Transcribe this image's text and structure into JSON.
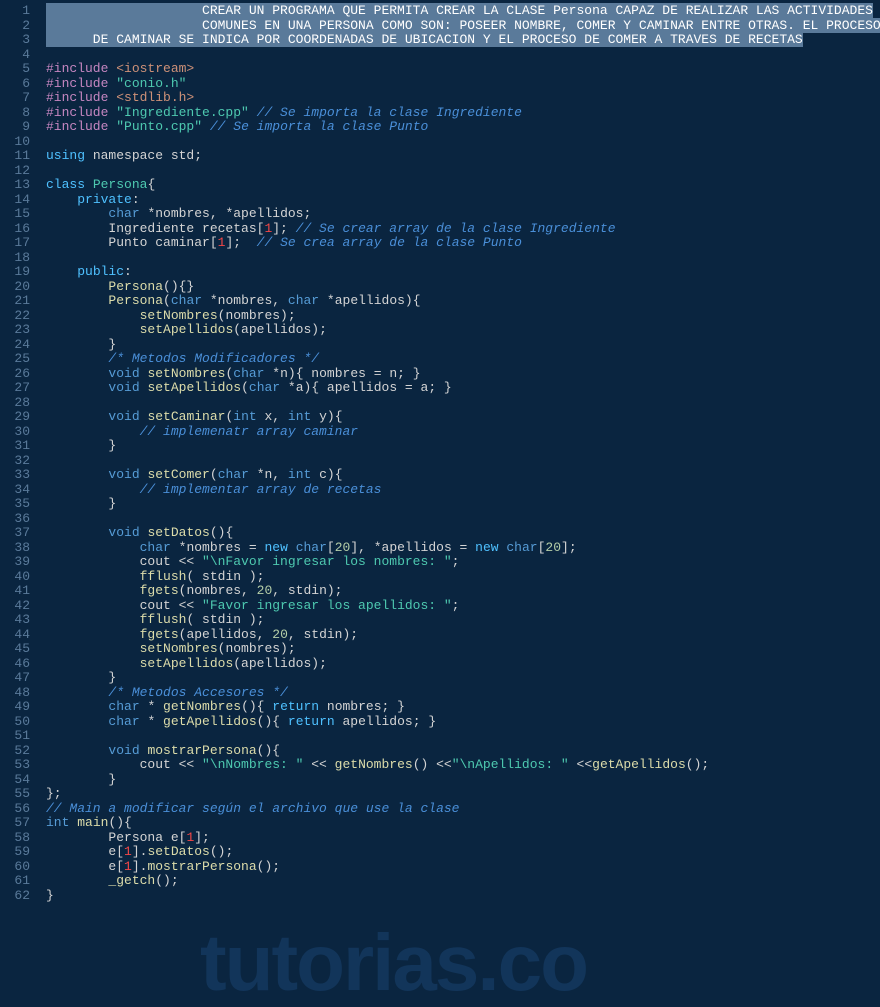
{
  "watermark": "tutorias.co",
  "lines": [
    {
      "n": 1,
      "tokens": [
        {
          "c": "hl-bg",
          "t": "                    CREAR UN PROGRAMA QUE PERMITA CREAR LA CLASE Persona CAPAZ DE REALIZAR LAS ACTIVIDADES"
        }
      ]
    },
    {
      "n": 2,
      "tokens": [
        {
          "c": "hl-bg",
          "t": "                    COMUNES EN UNA PERSONA COMO SON: POSEER NOMBRE, COMER Y CAMINAR ENTRE OTRAS. EL PROCESO"
        }
      ]
    },
    {
      "n": 3,
      "tokens": [
        {
          "c": "hl-bg",
          "t": "      DE CAMINAR SE INDICA POR COORDENADAS DE UBICACION Y EL PROCESO DE COMER A TRAVES DE RECETAS"
        }
      ]
    },
    {
      "n": 4,
      "tokens": []
    },
    {
      "n": 5,
      "tokens": [
        {
          "c": "tk-preproc",
          "t": "#include "
        },
        {
          "c": "tk-string",
          "t": "<iostream>"
        }
      ]
    },
    {
      "n": 6,
      "tokens": [
        {
          "c": "tk-preproc",
          "t": "#include "
        },
        {
          "c": "tk-string2",
          "t": "\"conio.h\""
        }
      ]
    },
    {
      "n": 7,
      "tokens": [
        {
          "c": "tk-preproc",
          "t": "#include "
        },
        {
          "c": "tk-string",
          "t": "<stdlib.h>"
        }
      ]
    },
    {
      "n": 8,
      "tokens": [
        {
          "c": "tk-preproc",
          "t": "#include "
        },
        {
          "c": "tk-string2",
          "t": "\"Ingrediente.cpp\""
        },
        {
          "c": "",
          "t": " "
        },
        {
          "c": "tk-comment2",
          "t": "// Se importa la clase Ingrediente"
        }
      ]
    },
    {
      "n": 9,
      "tokens": [
        {
          "c": "tk-preproc",
          "t": "#include "
        },
        {
          "c": "tk-string2",
          "t": "\"Punto.cpp\""
        },
        {
          "c": "",
          "t": " "
        },
        {
          "c": "tk-comment2",
          "t": "// Se importa la clase Punto"
        }
      ]
    },
    {
      "n": 10,
      "tokens": []
    },
    {
      "n": 11,
      "tokens": [
        {
          "c": "tk-keyword",
          "t": "using"
        },
        {
          "c": "",
          "t": " namespace std;"
        }
      ]
    },
    {
      "n": 12,
      "tokens": []
    },
    {
      "n": 13,
      "tokens": [
        {
          "c": "tk-keyword",
          "t": "class"
        },
        {
          "c": "",
          "t": " "
        },
        {
          "c": "tk-class",
          "t": "Persona"
        },
        {
          "c": "",
          "t": "{"
        }
      ]
    },
    {
      "n": 14,
      "tokens": [
        {
          "c": "",
          "t": "    "
        },
        {
          "c": "tk-keyword",
          "t": "private"
        },
        {
          "c": "",
          "t": ":"
        }
      ]
    },
    {
      "n": 15,
      "tokens": [
        {
          "c": "",
          "t": "        "
        },
        {
          "c": "tk-type",
          "t": "char"
        },
        {
          "c": "",
          "t": " *nombres, *apellidos;"
        }
      ]
    },
    {
      "n": 16,
      "tokens": [
        {
          "c": "",
          "t": "        Ingrediente recetas["
        },
        {
          "c": "tk-red",
          "t": "1"
        },
        {
          "c": "",
          "t": "]; "
        },
        {
          "c": "tk-comment2",
          "t": "// Se crear array de la clase Ingrediente"
        }
      ]
    },
    {
      "n": 17,
      "tokens": [
        {
          "c": "",
          "t": "        Punto caminar["
        },
        {
          "c": "tk-red",
          "t": "1"
        },
        {
          "c": "",
          "t": "];  "
        },
        {
          "c": "tk-comment2",
          "t": "// Se crea array de la clase Punto"
        }
      ]
    },
    {
      "n": 18,
      "tokens": []
    },
    {
      "n": 19,
      "tokens": [
        {
          "c": "",
          "t": "    "
        },
        {
          "c": "tk-keyword",
          "t": "public"
        },
        {
          "c": "",
          "t": ":"
        }
      ]
    },
    {
      "n": 20,
      "tokens": [
        {
          "c": "",
          "t": "        "
        },
        {
          "c": "tk-func",
          "t": "Persona"
        },
        {
          "c": "",
          "t": "(){}"
        }
      ]
    },
    {
      "n": 21,
      "tokens": [
        {
          "c": "",
          "t": "        "
        },
        {
          "c": "tk-func",
          "t": "Persona"
        },
        {
          "c": "",
          "t": "("
        },
        {
          "c": "tk-type",
          "t": "char"
        },
        {
          "c": "",
          "t": " *nombres, "
        },
        {
          "c": "tk-type",
          "t": "char"
        },
        {
          "c": "",
          "t": " *apellidos){"
        }
      ]
    },
    {
      "n": 22,
      "tokens": [
        {
          "c": "",
          "t": "            "
        },
        {
          "c": "tk-func",
          "t": "setNombres"
        },
        {
          "c": "",
          "t": "(nombres);"
        }
      ]
    },
    {
      "n": 23,
      "tokens": [
        {
          "c": "",
          "t": "            "
        },
        {
          "c": "tk-func",
          "t": "setApellidos"
        },
        {
          "c": "",
          "t": "(apellidos);"
        }
      ]
    },
    {
      "n": 24,
      "tokens": [
        {
          "c": "",
          "t": "        }"
        }
      ]
    },
    {
      "n": 25,
      "tokens": [
        {
          "c": "",
          "t": "        "
        },
        {
          "c": "tk-comment2",
          "t": "/* Metodos Modificadores */"
        }
      ]
    },
    {
      "n": 26,
      "tokens": [
        {
          "c": "",
          "t": "        "
        },
        {
          "c": "tk-type",
          "t": "void"
        },
        {
          "c": "",
          "t": " "
        },
        {
          "c": "tk-func",
          "t": "setNombres"
        },
        {
          "c": "",
          "t": "("
        },
        {
          "c": "tk-type",
          "t": "char"
        },
        {
          "c": "",
          "t": " *n){ nombres = n; }"
        }
      ]
    },
    {
      "n": 27,
      "tokens": [
        {
          "c": "",
          "t": "        "
        },
        {
          "c": "tk-type",
          "t": "void"
        },
        {
          "c": "",
          "t": " "
        },
        {
          "c": "tk-func",
          "t": "setApellidos"
        },
        {
          "c": "",
          "t": "("
        },
        {
          "c": "tk-type",
          "t": "char"
        },
        {
          "c": "",
          "t": " *a){ apellidos = a; }"
        }
      ]
    },
    {
      "n": 28,
      "tokens": []
    },
    {
      "n": 29,
      "tokens": [
        {
          "c": "",
          "t": "        "
        },
        {
          "c": "tk-type",
          "t": "void"
        },
        {
          "c": "",
          "t": " "
        },
        {
          "c": "tk-func",
          "t": "setCaminar"
        },
        {
          "c": "",
          "t": "("
        },
        {
          "c": "tk-type",
          "t": "int"
        },
        {
          "c": "",
          "t": " x, "
        },
        {
          "c": "tk-type",
          "t": "int"
        },
        {
          "c": "",
          "t": " y){"
        }
      ]
    },
    {
      "n": 30,
      "tokens": [
        {
          "c": "",
          "t": "            "
        },
        {
          "c": "tk-comment2",
          "t": "// implemenatr array caminar"
        }
      ]
    },
    {
      "n": 31,
      "tokens": [
        {
          "c": "",
          "t": "        }"
        }
      ]
    },
    {
      "n": 32,
      "tokens": []
    },
    {
      "n": 33,
      "tokens": [
        {
          "c": "",
          "t": "        "
        },
        {
          "c": "tk-type",
          "t": "void"
        },
        {
          "c": "",
          "t": " "
        },
        {
          "c": "tk-func",
          "t": "setComer"
        },
        {
          "c": "",
          "t": "("
        },
        {
          "c": "tk-type",
          "t": "char"
        },
        {
          "c": "",
          "t": " *n, "
        },
        {
          "c": "tk-type",
          "t": "int"
        },
        {
          "c": "",
          "t": " c){"
        }
      ]
    },
    {
      "n": 34,
      "tokens": [
        {
          "c": "",
          "t": "            "
        },
        {
          "c": "tk-comment2",
          "t": "// implementar array de recetas"
        }
      ]
    },
    {
      "n": 35,
      "tokens": [
        {
          "c": "",
          "t": "        }"
        }
      ]
    },
    {
      "n": 36,
      "tokens": []
    },
    {
      "n": 37,
      "tokens": [
        {
          "c": "",
          "t": "        "
        },
        {
          "c": "tk-type",
          "t": "void"
        },
        {
          "c": "",
          "t": " "
        },
        {
          "c": "tk-func",
          "t": "setDatos"
        },
        {
          "c": "",
          "t": "(){"
        }
      ]
    },
    {
      "n": 38,
      "tokens": [
        {
          "c": "",
          "t": "            "
        },
        {
          "c": "tk-type",
          "t": "char"
        },
        {
          "c": "",
          "t": " *nombres = "
        },
        {
          "c": "tk-keyword",
          "t": "new"
        },
        {
          "c": "",
          "t": " "
        },
        {
          "c": "tk-type",
          "t": "char"
        },
        {
          "c": "",
          "t": "["
        },
        {
          "c": "tk-number",
          "t": "20"
        },
        {
          "c": "",
          "t": "], *apellidos = "
        },
        {
          "c": "tk-keyword",
          "t": "new"
        },
        {
          "c": "",
          "t": " "
        },
        {
          "c": "tk-type",
          "t": "char"
        },
        {
          "c": "",
          "t": "["
        },
        {
          "c": "tk-number",
          "t": "20"
        },
        {
          "c": "",
          "t": "];"
        }
      ]
    },
    {
      "n": 39,
      "tokens": [
        {
          "c": "",
          "t": "            cout << "
        },
        {
          "c": "tk-string2",
          "t": "\"\\nFavor ingresar los nombres: \""
        },
        {
          "c": "",
          "t": ";"
        }
      ]
    },
    {
      "n": 40,
      "tokens": [
        {
          "c": "",
          "t": "            "
        },
        {
          "c": "tk-func",
          "t": "fflush"
        },
        {
          "c": "",
          "t": "( stdin );"
        }
      ]
    },
    {
      "n": 41,
      "tokens": [
        {
          "c": "",
          "t": "            "
        },
        {
          "c": "tk-func",
          "t": "fgets"
        },
        {
          "c": "",
          "t": "(nombres, "
        },
        {
          "c": "tk-number",
          "t": "20"
        },
        {
          "c": "",
          "t": ", stdin);"
        }
      ]
    },
    {
      "n": 42,
      "tokens": [
        {
          "c": "",
          "t": "            cout << "
        },
        {
          "c": "tk-string2",
          "t": "\"Favor ingresar los apellidos: \""
        },
        {
          "c": "",
          "t": ";"
        }
      ]
    },
    {
      "n": 43,
      "tokens": [
        {
          "c": "",
          "t": "            "
        },
        {
          "c": "tk-func",
          "t": "fflush"
        },
        {
          "c": "",
          "t": "( stdin );"
        }
      ]
    },
    {
      "n": 44,
      "tokens": [
        {
          "c": "",
          "t": "            "
        },
        {
          "c": "tk-func",
          "t": "fgets"
        },
        {
          "c": "",
          "t": "(apellidos, "
        },
        {
          "c": "tk-number",
          "t": "20"
        },
        {
          "c": "",
          "t": ", stdin);"
        }
      ]
    },
    {
      "n": 45,
      "tokens": [
        {
          "c": "",
          "t": "            "
        },
        {
          "c": "tk-func",
          "t": "setNombres"
        },
        {
          "c": "",
          "t": "(nombres);"
        }
      ]
    },
    {
      "n": 46,
      "tokens": [
        {
          "c": "",
          "t": "            "
        },
        {
          "c": "tk-func",
          "t": "setApellidos"
        },
        {
          "c": "",
          "t": "(apellidos);"
        }
      ]
    },
    {
      "n": 47,
      "tokens": [
        {
          "c": "",
          "t": "        }"
        }
      ]
    },
    {
      "n": 48,
      "tokens": [
        {
          "c": "",
          "t": "        "
        },
        {
          "c": "tk-comment2",
          "t": "/* Metodos Accesores */"
        }
      ]
    },
    {
      "n": 49,
      "tokens": [
        {
          "c": "",
          "t": "        "
        },
        {
          "c": "tk-type",
          "t": "char"
        },
        {
          "c": "",
          "t": " * "
        },
        {
          "c": "tk-func",
          "t": "getNombres"
        },
        {
          "c": "",
          "t": "(){ "
        },
        {
          "c": "tk-keyword",
          "t": "return"
        },
        {
          "c": "",
          "t": " nombres; }"
        }
      ]
    },
    {
      "n": 50,
      "tokens": [
        {
          "c": "",
          "t": "        "
        },
        {
          "c": "tk-type",
          "t": "char"
        },
        {
          "c": "",
          "t": " * "
        },
        {
          "c": "tk-func",
          "t": "getApellidos"
        },
        {
          "c": "",
          "t": "(){ "
        },
        {
          "c": "tk-keyword",
          "t": "return"
        },
        {
          "c": "",
          "t": " apellidos; }"
        }
      ]
    },
    {
      "n": 51,
      "tokens": []
    },
    {
      "n": 52,
      "tokens": [
        {
          "c": "",
          "t": "        "
        },
        {
          "c": "tk-type",
          "t": "void"
        },
        {
          "c": "",
          "t": " "
        },
        {
          "c": "tk-func",
          "t": "mostrarPersona"
        },
        {
          "c": "",
          "t": "(){"
        }
      ]
    },
    {
      "n": 53,
      "tokens": [
        {
          "c": "",
          "t": "            cout << "
        },
        {
          "c": "tk-string2",
          "t": "\"\\nNombres: \""
        },
        {
          "c": "",
          "t": " << "
        },
        {
          "c": "tk-func",
          "t": "getNombres"
        },
        {
          "c": "",
          "t": "() <<"
        },
        {
          "c": "tk-string2",
          "t": "\"\\nApellidos: \""
        },
        {
          "c": "",
          "t": " <<"
        },
        {
          "c": "tk-func",
          "t": "getApellidos"
        },
        {
          "c": "",
          "t": "();"
        }
      ]
    },
    {
      "n": 54,
      "tokens": [
        {
          "c": "",
          "t": "        }"
        }
      ]
    },
    {
      "n": 55,
      "tokens": [
        {
          "c": "",
          "t": "};"
        }
      ]
    },
    {
      "n": 56,
      "tokens": [
        {
          "c": "tk-comment2",
          "t": "// Main a modificar según el archivo que use la clase"
        }
      ]
    },
    {
      "n": 57,
      "tokens": [
        {
          "c": "tk-type",
          "t": "int"
        },
        {
          "c": "",
          "t": " "
        },
        {
          "c": "tk-func",
          "t": "main"
        },
        {
          "c": "",
          "t": "(){"
        }
      ]
    },
    {
      "n": 58,
      "tokens": [
        {
          "c": "",
          "t": "        Persona e["
        },
        {
          "c": "tk-red",
          "t": "1"
        },
        {
          "c": "",
          "t": "];"
        }
      ]
    },
    {
      "n": 59,
      "tokens": [
        {
          "c": "",
          "t": "        e["
        },
        {
          "c": "tk-red",
          "t": "1"
        },
        {
          "c": "",
          "t": "]."
        },
        {
          "c": "tk-func",
          "t": "setDatos"
        },
        {
          "c": "",
          "t": "();"
        }
      ]
    },
    {
      "n": 60,
      "tokens": [
        {
          "c": "",
          "t": "        e["
        },
        {
          "c": "tk-red",
          "t": "1"
        },
        {
          "c": "",
          "t": "]."
        },
        {
          "c": "tk-func",
          "t": "mostrarPersona"
        },
        {
          "c": "",
          "t": "();"
        }
      ]
    },
    {
      "n": 61,
      "tokens": [
        {
          "c": "",
          "t": "        "
        },
        {
          "c": "tk-func",
          "t": "_getch"
        },
        {
          "c": "",
          "t": "();"
        }
      ]
    },
    {
      "n": 62,
      "tokens": [
        {
          "c": "",
          "t": "}"
        }
      ]
    }
  ]
}
